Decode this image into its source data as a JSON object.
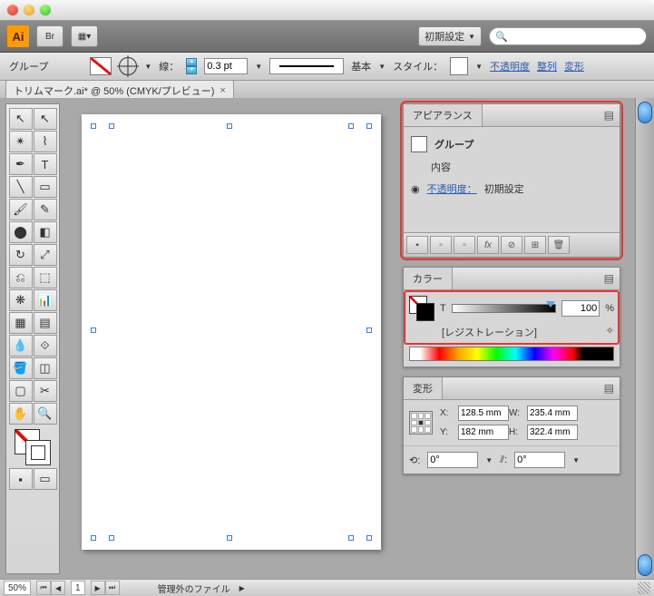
{
  "appbar": {
    "br_label": "Br",
    "workspace_preset": "初期設定"
  },
  "control": {
    "selection_label": "グループ",
    "stroke_label": "線：",
    "stroke_width": "0.3 pt",
    "stroke_cap": "基本",
    "style_label": "スタイル：",
    "opacity_link": "不透明度",
    "align_link": "整列",
    "transform_link": "変形"
  },
  "doc": {
    "tab_title": "トリムマーク.ai* @ 50% (CMYK/プレビュー)"
  },
  "panels": {
    "appearance": {
      "title": "アピアランス",
      "object_type": "グループ",
      "contents_label": "内容",
      "opacity_label": "不透明度：",
      "opacity_value": "初期設定"
    },
    "color": {
      "title": "カラー",
      "channel": "T",
      "value": "100",
      "percent": "%",
      "swatch_name": "[レジストレーション]"
    },
    "transform": {
      "title": "変形",
      "x_label": "X:",
      "x": "128.5 mm",
      "y_label": "Y:",
      "y": "182 mm",
      "w_label": "W:",
      "w": "235.4 mm",
      "h_label": "H:",
      "h": "322.4 mm",
      "angle": "0°",
      "shear": "0°"
    }
  },
  "status": {
    "zoom": "50%",
    "page": "1",
    "info": "管理外のファイル"
  }
}
